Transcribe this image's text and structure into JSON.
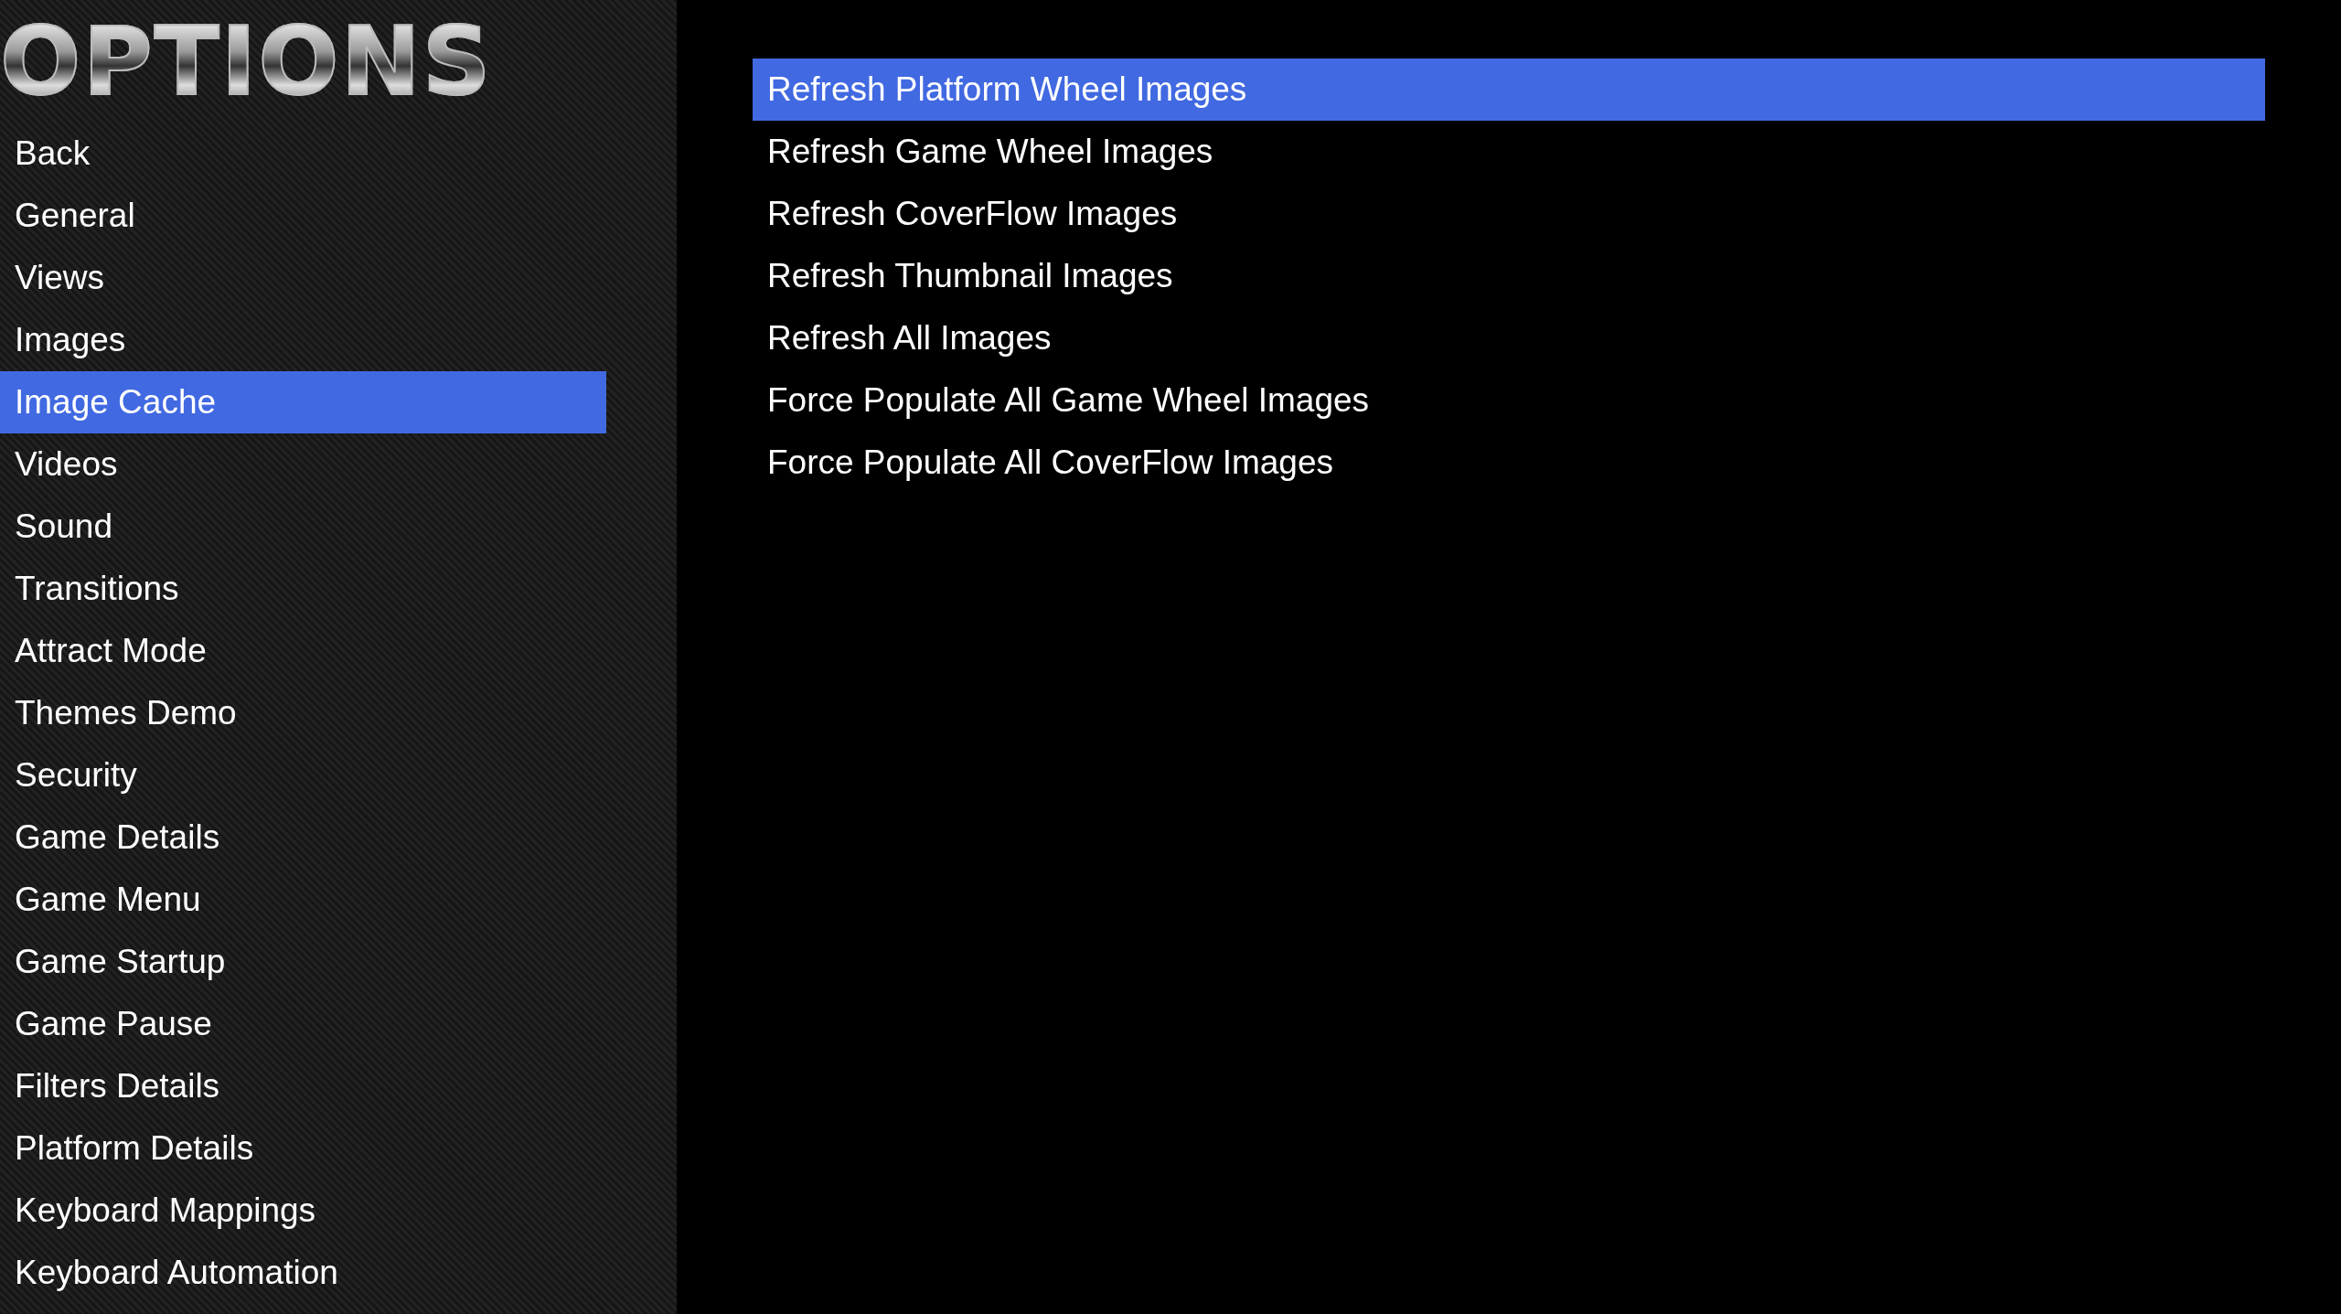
{
  "logo": {
    "text": "OPTIONS"
  },
  "sidebar": {
    "items": [
      {
        "label": "Back",
        "selected": false
      },
      {
        "label": "General",
        "selected": false
      },
      {
        "label": "Views",
        "selected": false
      },
      {
        "label": "Images",
        "selected": false
      },
      {
        "label": "Image Cache",
        "selected": true
      },
      {
        "label": "Videos",
        "selected": false
      },
      {
        "label": "Sound",
        "selected": false
      },
      {
        "label": "Transitions",
        "selected": false
      },
      {
        "label": "Attract Mode",
        "selected": false
      },
      {
        "label": "Themes Demo",
        "selected": false
      },
      {
        "label": "Security",
        "selected": false
      },
      {
        "label": "Game Details",
        "selected": false
      },
      {
        "label": "Game Menu",
        "selected": false
      },
      {
        "label": "Game Startup",
        "selected": false
      },
      {
        "label": "Game Pause",
        "selected": false
      },
      {
        "label": "Filters Details",
        "selected": false
      },
      {
        "label": "Platform Details",
        "selected": false
      },
      {
        "label": "Keyboard Mappings",
        "selected": false
      },
      {
        "label": "Keyboard Automation",
        "selected": false
      }
    ]
  },
  "options": {
    "items": [
      {
        "label": "Refresh Platform Wheel Images",
        "selected": true
      },
      {
        "label": "Refresh Game Wheel Images",
        "selected": false
      },
      {
        "label": "Refresh CoverFlow Images",
        "selected": false
      },
      {
        "label": "Refresh Thumbnail Images",
        "selected": false
      },
      {
        "label": "Refresh All Images",
        "selected": false
      },
      {
        "label": "Force Populate All Game Wheel Images",
        "selected": false
      },
      {
        "label": "Force Populate All CoverFlow Images",
        "selected": false
      }
    ]
  }
}
